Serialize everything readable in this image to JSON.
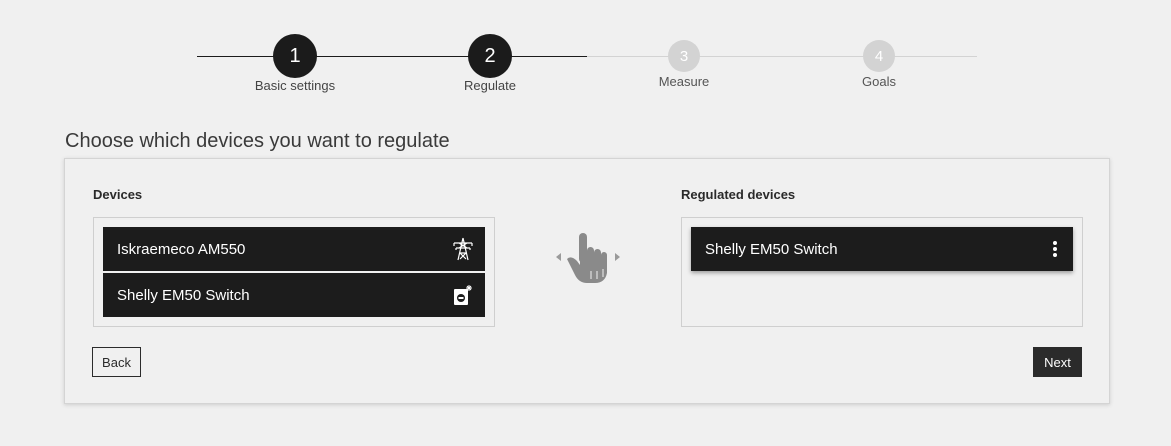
{
  "stepper": {
    "steps": [
      {
        "number": "1",
        "label": "Basic settings",
        "state": "active"
      },
      {
        "number": "2",
        "label": "Regulate",
        "state": "active"
      },
      {
        "number": "3",
        "label": "Measure",
        "state": "inactive"
      },
      {
        "number": "4",
        "label": "Goals",
        "state": "inactive"
      }
    ]
  },
  "page": {
    "title": "Choose which devices you want to regulate"
  },
  "devices": {
    "title": "Devices",
    "items": [
      {
        "name": "Iskraemeco AM550",
        "icon": "power-pylon-icon"
      },
      {
        "name": "Shelly EM50 Switch",
        "icon": "smart-plug-icon"
      }
    ]
  },
  "regulated": {
    "title": "Regulated devices",
    "items": [
      {
        "name": "Shelly EM50 Switch",
        "icon": "more-vertical-icon"
      }
    ]
  },
  "buttons": {
    "back": "Back",
    "next": "Next"
  },
  "colors": {
    "background": "#f0f0f0",
    "active_step": "#1b1b1b",
    "inactive_step": "#d3d3d3",
    "device_bg": "#1c1c1c",
    "hint_icon": "#8a8a8a"
  }
}
